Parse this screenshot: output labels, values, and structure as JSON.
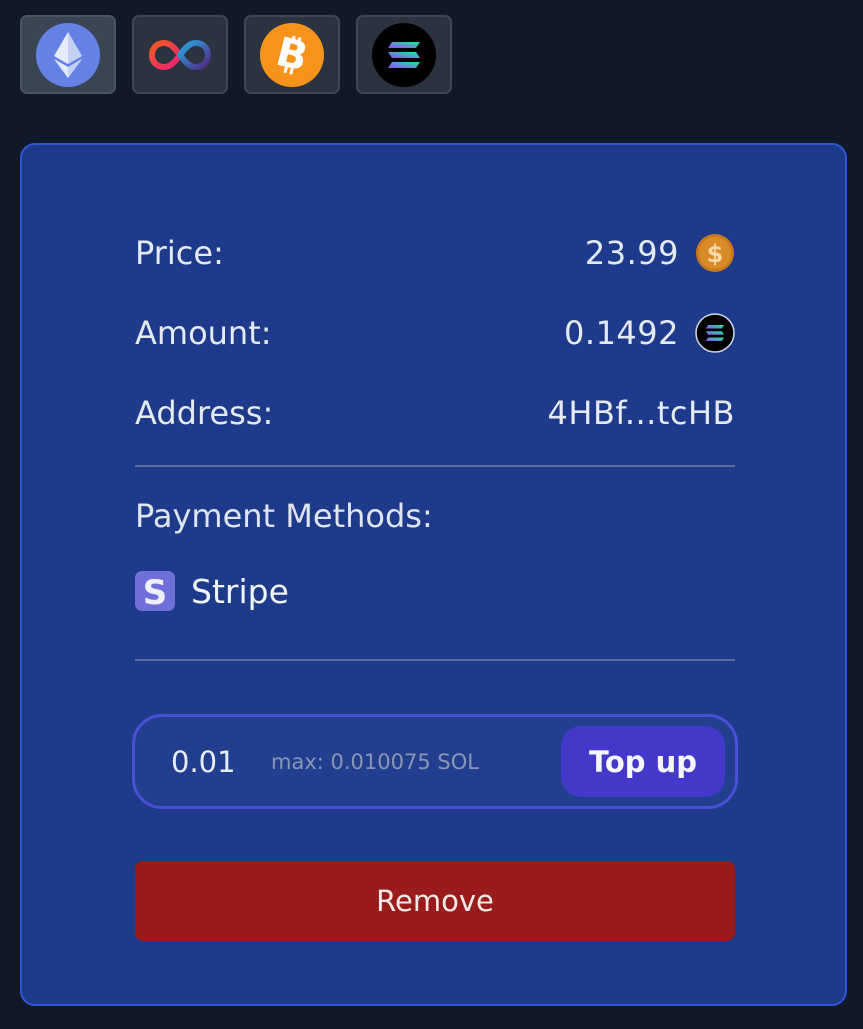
{
  "chains": [
    {
      "id": "ethereum",
      "icon": "ethereum-icon",
      "active": true
    },
    {
      "id": "internet-computer",
      "icon": "internet-computer-icon",
      "active": false
    },
    {
      "id": "bitcoin",
      "icon": "bitcoin-icon",
      "active": false
    },
    {
      "id": "solana",
      "icon": "solana-icon",
      "active": false
    }
  ],
  "card": {
    "price_label": "Price:",
    "price_value": "23.99",
    "price_icon": "usd-coin-icon",
    "amount_label": "Amount:",
    "amount_value": "0.1492",
    "amount_icon": "solana-icon",
    "address_label": "Address:",
    "address_value": "4HBf...tcHB",
    "payment_methods_label": "Payment Methods:",
    "payment_methods": [
      {
        "name": "Stripe",
        "icon": "stripe-icon"
      }
    ],
    "topup": {
      "input_value": "0.01",
      "max_text": "max: 0.010075 SOL",
      "button_label": "Top up"
    },
    "remove_label": "Remove"
  },
  "colors": {
    "background": "#111827",
    "card": "#1e3a8a",
    "accent": "#4338ca",
    "danger": "#991b1b"
  }
}
